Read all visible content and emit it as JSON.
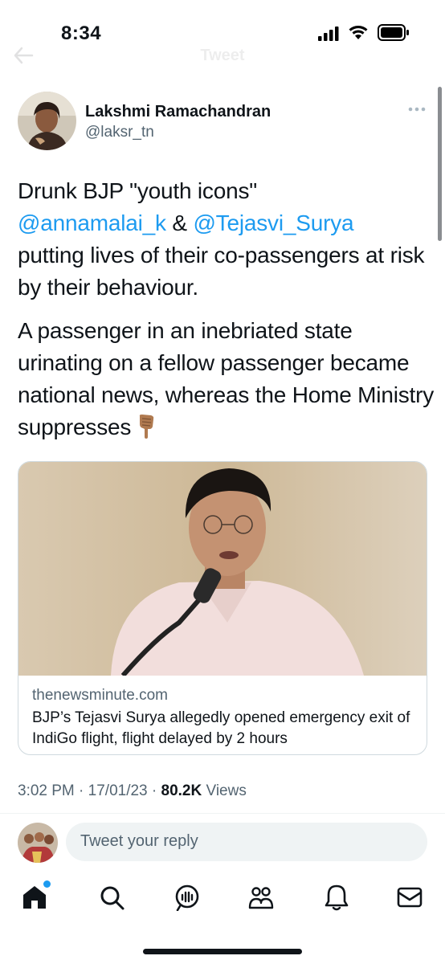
{
  "status_bar": {
    "time": "8:34"
  },
  "nav": {
    "title": "Tweet"
  },
  "author": {
    "name": "Lakshmi Ramachandran",
    "handle": "@laksr_tn"
  },
  "tweet": {
    "line1": "Drunk BJP \"youth icons\"",
    "mention1": "@annamalai_k",
    "amp": " & ",
    "mention2": "@Tejasvi_Surya",
    "line3": "putting lives of their co-passengers at risk by their behaviour.",
    "paragraph2": "A passenger in an inebriated state urinating on a fellow passenger became national news, whereas the Home Ministry suppresses",
    "emoji": "backhand-index-pointing-down-icon"
  },
  "link_card": {
    "domain": "thenewsminute.com",
    "title": "BJP’s Tejasvi Surya allegedly opened emergency exit of IndiGo flight, flight delayed by 2 hours"
  },
  "meta": {
    "time": "3:02 PM",
    "sep1": " · ",
    "date": "17/01/23",
    "sep2": " · ",
    "views_count": "80.2K",
    "views_label": " Views"
  },
  "reply": {
    "placeholder": "Tweet your reply"
  },
  "tabs": [
    "home-icon",
    "search-icon",
    "spaces-icon",
    "communities-icon",
    "notifications-icon",
    "messages-icon"
  ],
  "colors": {
    "accent": "#1d9bf0",
    "text": "#0f1419",
    "secondary": "#536471"
  }
}
